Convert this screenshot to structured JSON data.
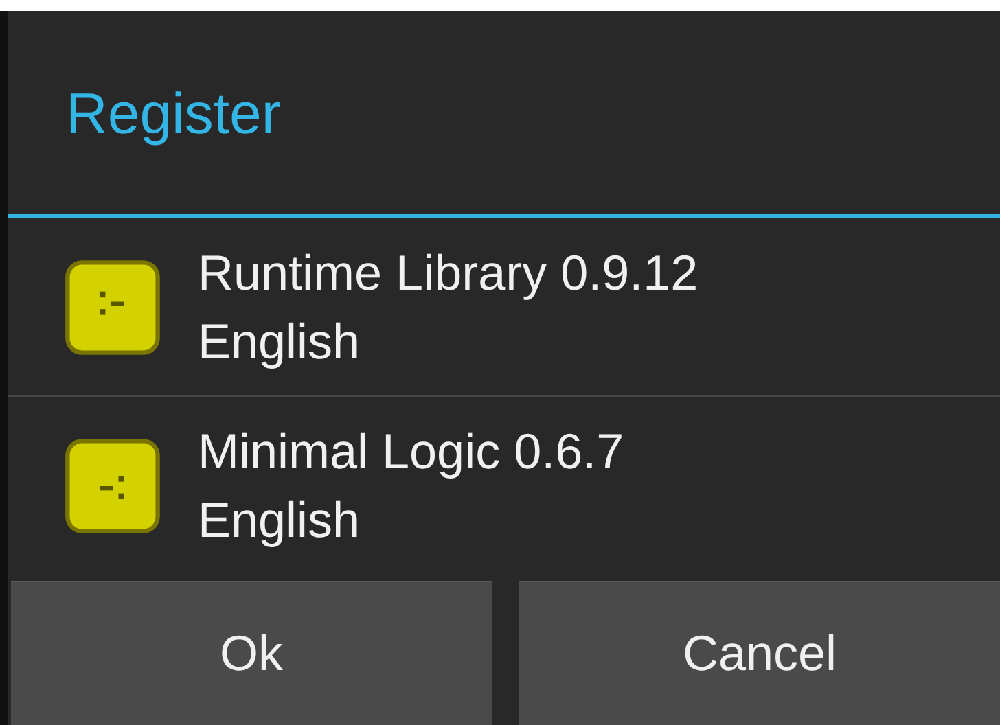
{
  "dialog": {
    "title": "Register"
  },
  "items": [
    {
      "kind": "colon-dash",
      "name": "Runtime Library 0.9.12",
      "language": "English"
    },
    {
      "kind": "dash-colon",
      "name": "Minimal Logic 0.6.7",
      "language": "English"
    }
  ],
  "buttons": [
    "Ok",
    "Cancel"
  ]
}
